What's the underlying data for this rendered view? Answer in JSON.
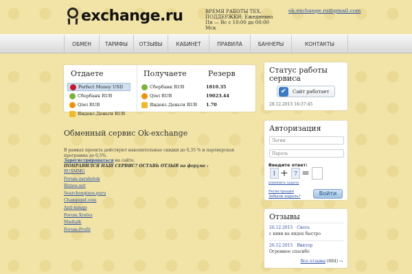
{
  "header": {
    "logo_text": "exchange.ru",
    "worktime": "ВРЕМЯ РАБОТЫ ТЕХ. ПОДДЕРЖКИ: Ежедневно Пн — Вс с 10:00 до 00:00 Мск",
    "email": "ok.exchange.ru@gmail.com"
  },
  "nav": [
    "ОБМЕН",
    "ТАРИФЫ",
    "ОТЗЫВЫ",
    "КАБИНЕТ",
    "ПРАВИЛА",
    "БАННЕРЫ",
    "КОНТАКТЫ"
  ],
  "exchange": {
    "give_title": "Отдаете",
    "get_title": "Получаете",
    "reserve_title": "Резерв",
    "give_items": [
      {
        "name": "Perfect Money USD",
        "icon": "perfect-money-icon"
      },
      {
        "name": "Сбербанк RUB",
        "icon": "sberbank-icon"
      },
      {
        "name": "Qiwi RUB",
        "icon": "qiwi-icon"
      },
      {
        "name": "Яндекс.Деньги RUB",
        "icon": "yandex-money-icon"
      }
    ],
    "get_items": [
      {
        "name": "Сбербанк RUB",
        "amount": "1810.35",
        "icon": "sberbank-icon"
      },
      {
        "name": "Qiwi RUB",
        "amount": "19023.44",
        "icon": "qiwi-icon"
      },
      {
        "name": "Яндекс.Деньги RUB",
        "amount": "1.70",
        "icon": "yandex-money-icon"
      }
    ]
  },
  "status": {
    "title": "Статус работы сервиса",
    "button": "Сайт работает",
    "date": "28.12.2015 16:37:45"
  },
  "service": {
    "title": "Обменный сервис Ok-exchange",
    "text": "В рамках проекта действуют накопительные скидки до 0,35 % и партнерская программа до 0,5%.",
    "register": "Зарегистрироваться",
    "register_tail": " на сайте.",
    "cta": "ПОНРАВИЛСЯ НАШ СЕРВИС? ОСТАВЬ ОТЗЫВ на форуме :",
    "links": [
      "BUSMMG",
      "Forum-zarubotok",
      "Biznes.net",
      "Searchengines.guru",
      "Changegid.com",
      "Anti-mmgp",
      "Forum.Xrates",
      "Mmltalk",
      "Forum-Profit"
    ]
  },
  "auth": {
    "title": "Авторизация",
    "login_placeholder": "Логин",
    "password_placeholder": "Пароль",
    "captcha_label": "Введите ответ:",
    "captcha_a": "1",
    "captcha_op": "+",
    "captcha_b": "7",
    "captcha_eq": "=",
    "change_tasks": "изменить задачу",
    "register": "Регистрация",
    "forgot": "Забыли пароль?",
    "login_button": "Войти"
  },
  "reviews": {
    "title": "Отзывы",
    "items": [
      {
        "date": "26.12.2015",
        "name": "Света",
        "text": "с киви на яндек быстро"
      },
      {
        "date": "26.12.2015",
        "name": "Виктор",
        "text": "Огромное спасибо"
      }
    ],
    "all_label": "Все отзывы",
    "all_count": " (884) →"
  }
}
